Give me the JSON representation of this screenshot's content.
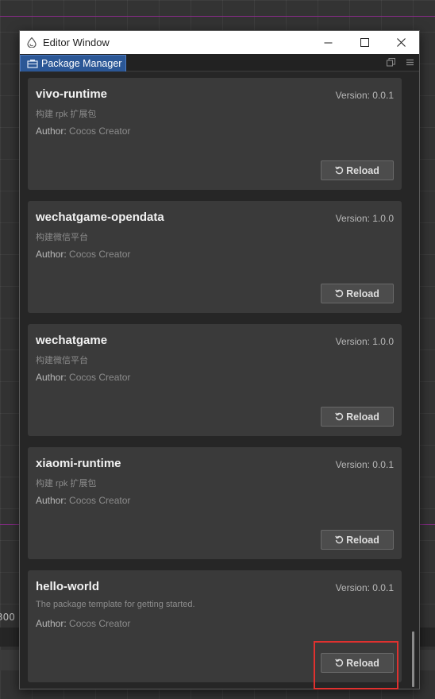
{
  "window": {
    "title": "Editor Window"
  },
  "tab": {
    "label": "Package Manager"
  },
  "background": {
    "axis_label_left": "300"
  },
  "packages": [
    {
      "name": "vivo-runtime",
      "version": "Version: 0.0.1",
      "description": "构建 rpk 扩展包",
      "author_label": "Author:",
      "author": "Cocos Creator",
      "reload_label": "Reload"
    },
    {
      "name": "wechatgame-opendata",
      "version": "Version: 1.0.0",
      "description": "构建微信平台",
      "author_label": "Author:",
      "author": "Cocos Creator",
      "reload_label": "Reload"
    },
    {
      "name": "wechatgame",
      "version": "Version: 1.0.0",
      "description": "构建微信平台",
      "author_label": "Author:",
      "author": "Cocos Creator",
      "reload_label": "Reload"
    },
    {
      "name": "xiaomi-runtime",
      "version": "Version: 0.0.1",
      "description": "构建 rpk 扩展包",
      "author_label": "Author:",
      "author": "Cocos Creator",
      "reload_label": "Reload"
    },
    {
      "name": "hello-world",
      "version": "Version: 0.0.1",
      "description": "The package template for getting started.",
      "author_label": "Author:",
      "author": "Cocos Creator",
      "reload_label": "Reload"
    }
  ],
  "colors": {
    "highlight": "#e0312f",
    "tab_active": "#2b5796"
  },
  "icons": {
    "app": "cocos-drop-icon",
    "tab": "package-icon",
    "reload": "reload-icon"
  }
}
